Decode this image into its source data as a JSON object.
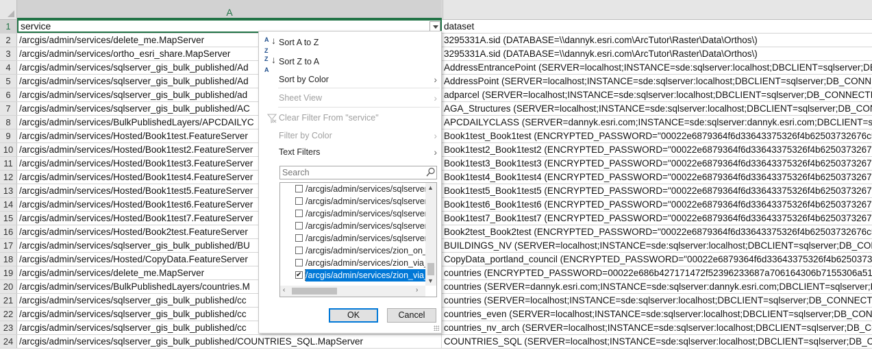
{
  "sheet": {
    "column_header": "A",
    "rows": [
      {
        "num": "1",
        "a": "service",
        "b": "dataset"
      },
      {
        "num": "2",
        "a": "/arcgis/admin/services/delete_me.MapServer",
        "b": "3295331A.sid (DATABASE=\\\\dannyk.esri.com\\ArcTutor\\Raster\\Data\\Orthos\\)"
      },
      {
        "num": "3",
        "a": "/arcgis/admin/services/ortho_esri_share.MapServer",
        "b": "3295331A.sid (DATABASE=\\\\dannyk.esri.com\\ArcTutor\\Raster\\Data\\Orthos\\)"
      },
      {
        "num": "4",
        "a": "/arcgis/admin/services/sqlserver_gis_bulk_published/Ad",
        "b": "AddressEntrancePoint (SERVER=localhost;INSTANCE=sde:sqlserver:localhost;DBCLIENT=sqlserver;DB_"
      },
      {
        "num": "5",
        "a": "/arcgis/admin/services/sqlserver_gis_bulk_published/Ad",
        "b": "AddressPoint (SERVER=localhost;INSTANCE=sde:sqlserver:localhost;DBCLIENT=sqlserver;DB_CONNECT"
      },
      {
        "num": "6",
        "a": "/arcgis/admin/services/sqlserver_gis_bulk_published/ad",
        "b": "adparcel (SERVER=localhost;INSTANCE=sde:sqlserver:localhost;DBCLIENT=sqlserver;DB_CONNECTION"
      },
      {
        "num": "7",
        "a": "/arcgis/admin/services/sqlserver_gis_bulk_published/AC",
        "b": "AGA_Structures (SERVER=localhost;INSTANCE=sde:sqlserver:localhost;DBCLIENT=sqlserver;DB_CONNE"
      },
      {
        "num": "8",
        "a": "/arcgis/admin/services/BulkPublishedLayers/APCDAILYC",
        "b": "APCDAILYCLASS (SERVER=dannyk.esri.com;INSTANCE=sde:sqlserver:dannyk.esri.com;DBCLIENT=sqlse"
      },
      {
        "num": "9",
        "a": "/arcgis/admin/services/Hosted/Book1test.FeatureServer",
        "b": "Book1test_Book1test (ENCRYPTED_PASSWORD=\"00022e6879364f6d33643375326f4b62503732676c58394"
      },
      {
        "num": "10",
        "a": "/arcgis/admin/services/Hosted/Book1test2.FeatureServer",
        "b": "Book1test2_Book1test2 (ENCRYPTED_PASSWORD=\"00022e6879364f6d33643375326f4b62503732676c583"
      },
      {
        "num": "11",
        "a": "/arcgis/admin/services/Hosted/Book1test3.FeatureServer",
        "b": "Book1test3_Book1test3 (ENCRYPTED_PASSWORD=\"00022e6879364f6d33643375326f4b62503732676c583"
      },
      {
        "num": "12",
        "a": "/arcgis/admin/services/Hosted/Book1test4.FeatureServer",
        "b": "Book1test4_Book1test4 (ENCRYPTED_PASSWORD=\"00022e6879364f6d33643375326f4b62503732676c583"
      },
      {
        "num": "13",
        "a": "/arcgis/admin/services/Hosted/Book1test5.FeatureServer",
        "b": "Book1test5_Book1test5 (ENCRYPTED_PASSWORD=\"00022e6879364f6d33643375326f4b62503732676c583"
      },
      {
        "num": "14",
        "a": "/arcgis/admin/services/Hosted/Book1test6.FeatureServer",
        "b": "Book1test6_Book1test6 (ENCRYPTED_PASSWORD=\"00022e6879364f6d33643375326f4b62503732676c583"
      },
      {
        "num": "15",
        "a": "/arcgis/admin/services/Hosted/Book1test7.FeatureServer",
        "b": "Book1test7_Book1test7 (ENCRYPTED_PASSWORD=\"00022e6879364f6d33643375326f4b62503732676c583"
      },
      {
        "num": "16",
        "a": "/arcgis/admin/services/Hosted/Book2test.FeatureServer",
        "b": "Book2test_Book2test (ENCRYPTED_PASSWORD=\"00022e6879364f6d33643375326f4b62503732676c58394"
      },
      {
        "num": "17",
        "a": "/arcgis/admin/services/sqlserver_gis_bulk_published/BU",
        "b": "BUILDINGS_NV (SERVER=localhost;INSTANCE=sde:sqlserver:localhost;DBCLIENT=sqlserver;DB_CONNE"
      },
      {
        "num": "18",
        "a": "/arcgis/admin/services/Hosted/CopyData.FeatureServer",
        "b": "CopyData_portland_council (ENCRYPTED_PASSWORD=\"00022e6879364f6d33643375326f4b62503732676"
      },
      {
        "num": "19",
        "a": "/arcgis/admin/services/delete_me.MapServer",
        "b": "countries (ENCRYPTED_PASSWORD=00022e686b427171472f52396233687a706164306b7155306a513d3d2"
      },
      {
        "num": "20",
        "a": "/arcgis/admin/services/BulkPublishedLayers/countries.M",
        "b": "countries (SERVER=dannyk.esri.com;INSTANCE=sde:sqlserver:dannyk.esri.com;DBCLIENT=sqlserver;DI"
      },
      {
        "num": "21",
        "a": "/arcgis/admin/services/sqlserver_gis_bulk_published/cc",
        "b": "countries (SERVER=localhost;INSTANCE=sde:sqlserver:localhost;DBCLIENT=sqlserver;DB_CONNECTION"
      },
      {
        "num": "22",
        "a": "/arcgis/admin/services/sqlserver_gis_bulk_published/cc",
        "b": "countries_even (SERVER=localhost;INSTANCE=sde:sqlserver:localhost;DBCLIENT=sqlserver;DB_CONNE"
      },
      {
        "num": "23",
        "a": "/arcgis/admin/services/sqlserver_gis_bulk_published/cc",
        "b": "countries_nv_arch (SERVER=localhost;INSTANCE=sde:sqlserver:localhost;DBCLIENT=sqlserver;DB_CONN"
      },
      {
        "num": "24",
        "a": "/arcgis/admin/services/sqlserver_gis_bulk_published/COUNTRIES_SQL.MapServer",
        "b": "COUNTRIES_SQL (SERVER=localhost;INSTANCE=sde:sqlserver:localhost;DBCLIENT=sqlserver;DB_CONN"
      }
    ]
  },
  "filter_menu": {
    "sort_a_z": "Sort A to Z",
    "sort_z_a": "Sort Z to A",
    "sort_by_color": "Sort by Color",
    "sheet_view": "Sheet View",
    "clear_filter": "Clear Filter From \"service\"",
    "filter_by_color": "Filter by Color",
    "text_filters": "Text Filters",
    "search_placeholder": "Search",
    "list_items": [
      {
        "label": "/arcgis/admin/services/sqlserver_",
        "checked": false
      },
      {
        "label": "/arcgis/admin/services/sqlserver_",
        "checked": false
      },
      {
        "label": "/arcgis/admin/services/sqlserver_",
        "checked": false
      },
      {
        "label": "/arcgis/admin/services/sqlserver_",
        "checked": false
      },
      {
        "label": "/arcgis/admin/services/sqlserver_",
        "checked": false
      },
      {
        "label": "/arcgis/admin/services/zion_on_",
        "checked": false
      },
      {
        "label": "/arcgis/admin/services/zion_via_",
        "checked": false
      },
      {
        "label": "/arcgis/admin/services/zion_via_",
        "checked": true
      }
    ],
    "ok_label": "OK",
    "cancel_label": "Cancel"
  },
  "colors": {
    "accent": "#217346",
    "selection": "#0078d7"
  }
}
